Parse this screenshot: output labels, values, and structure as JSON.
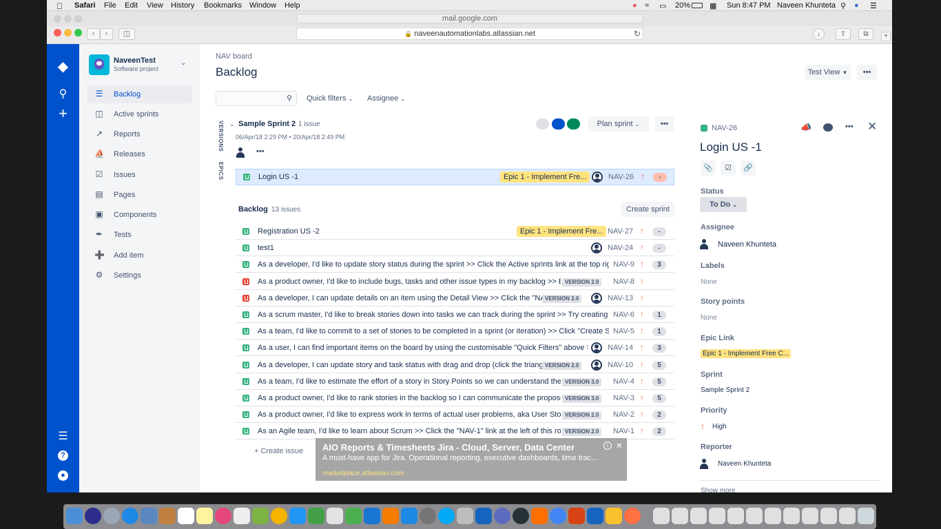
{
  "mac_menubar": {
    "apple": "",
    "items": [
      "Safari",
      "File",
      "Edit",
      "View",
      "History",
      "Bookmarks",
      "Window",
      "Help"
    ],
    "battery": "20%",
    "clock": "Sun 8:47 PM",
    "user": "Naveen Khunteta"
  },
  "browser": {
    "background_url": "mail.google.com",
    "url": "naveenautomationlabs.atlassian.net"
  },
  "project": {
    "name": "NaveenTest",
    "type": "Software project"
  },
  "sidebar": {
    "items": [
      {
        "label": "Backlog",
        "icon": "backlog-icon"
      },
      {
        "label": "Active sprints",
        "icon": "board-icon"
      },
      {
        "label": "Reports",
        "icon": "chart-icon"
      },
      {
        "label": "Releases",
        "icon": "ship-icon"
      },
      {
        "label": "Issues",
        "icon": "issues-icon"
      },
      {
        "label": "Pages",
        "icon": "page-icon"
      },
      {
        "label": "Components",
        "icon": "component-icon"
      },
      {
        "label": "Tests",
        "icon": "feather-icon"
      },
      {
        "label": "Add item",
        "icon": "add-item-icon"
      },
      {
        "label": "Settings",
        "icon": "gear-icon"
      }
    ]
  },
  "header": {
    "breadcrumb": "NAV board",
    "title": "Backlog",
    "view_button": "Test View",
    "more": "•••"
  },
  "filters": {
    "search_placeholder": "",
    "quick_filters": "Quick filters",
    "assignee": "Assignee"
  },
  "side_tabs": [
    "VERSIONS",
    "EPICS"
  ],
  "sprint": {
    "name": "Sample Sprint 2",
    "count": "1 issue",
    "dates": "06/Apr/18 2:29 PM • 20/Apr/18 2:49 PM",
    "plan_button": "Plan sprint",
    "colors": [
      "#dfe1e6",
      "#0052cc",
      "#00875a"
    ],
    "issue": {
      "title": "Login US -1",
      "epic": "Epic 1 - Implement Fre...",
      "key": "NAV-26",
      "points": "-"
    }
  },
  "backlog": {
    "title": "Backlog",
    "count": "13 issues",
    "create_sprint": "Create sprint",
    "create_issue": "+ Create issue",
    "rows": [
      {
        "type": "story",
        "title": "Registration US -2",
        "epic": "Epic 1 - Implement Fre...",
        "key": "NAV-27",
        "points": "-",
        "avatar": false,
        "version": ""
      },
      {
        "type": "story",
        "title": "test1",
        "epic": "",
        "key": "NAV-24",
        "points": "-",
        "avatar": true,
        "version": ""
      },
      {
        "type": "story",
        "title": "As a developer, I'd like to update story status during the sprint >> Click the Active sprints link at the top right",
        "epic": "",
        "key": "NAV-9",
        "points": "3",
        "avatar": false,
        "version": ""
      },
      {
        "type": "bug",
        "title": "As a product owner, I'd like to include bugs, tasks and other issue types in my backlog >> Bug",
        "epic": "",
        "key": "NAV-8",
        "points": "",
        "avatar": false,
        "version": "VERSION 2.0"
      },
      {
        "type": "bug",
        "title": "As a developer, I can update details on an item using the Detail View >> Click the \"NAV-",
        "epic": "",
        "key": "NAV-13",
        "points": "",
        "avatar": true,
        "version": "VERSION 2.0"
      },
      {
        "type": "story",
        "title": "As a scrum master, I'd like to break stories down into tasks we can track during the sprint >> Try creating a task",
        "epic": "",
        "key": "NAV-6",
        "points": "1",
        "avatar": false,
        "version": ""
      },
      {
        "type": "story",
        "title": "As a team, I'd like to commit to a set of stories to be completed in a sprint (or iteration) >> Click \"Create Sprint\"",
        "epic": "",
        "key": "NAV-5",
        "points": "1",
        "avatar": false,
        "version": ""
      },
      {
        "type": "story",
        "title": "As a user, I can find important items on the board by using the customisable \"Quick Filters\" above >> Try",
        "epic": "",
        "key": "NAV-14",
        "points": "3",
        "avatar": true,
        "version": ""
      },
      {
        "type": "story",
        "title": "As a developer, I can update story and task status with drag and drop (click the triangle",
        "epic": "",
        "key": "NAV-10",
        "points": "5",
        "avatar": true,
        "version": "VERSION 2.0"
      },
      {
        "type": "story",
        "title": "As a team, I'd like to estimate the effort of a story in Story Points so we can understand the work",
        "epic": "",
        "key": "NAV-4",
        "points": "5",
        "avatar": false,
        "version": "VERSION 3.0"
      },
      {
        "type": "story",
        "title": "As a product owner, I'd like to rank stories in the backlog so I can communicate the proposed",
        "epic": "",
        "key": "NAV-3",
        "points": "5",
        "avatar": false,
        "version": "VERSION 3.0"
      },
      {
        "type": "story",
        "title": "As a product owner, I'd like to express work in terms of actual user problems, aka User Stories",
        "epic": "",
        "key": "NAV-2",
        "points": "2",
        "avatar": false,
        "version": "VERSION 2.0"
      },
      {
        "type": "story",
        "title": "As an Agile team, I'd like to learn about Scrum >> Click the \"NAV-1\" link at the left of this row to",
        "epic": "",
        "key": "NAV-1",
        "points": "2",
        "avatar": false,
        "version": "VERSION 2.0"
      }
    ]
  },
  "detail": {
    "key": "NAV-26",
    "title": "Login US -1",
    "status_label": "Status",
    "status": "To Do",
    "assignee_label": "Assignee",
    "assignee": "Naveen Khunteta",
    "labels_label": "Labels",
    "labels": "None",
    "story_points_label": "Story points",
    "story_points": "None",
    "epic_label": "Epic Link",
    "epic": "Epic 1 - Implement Free C...",
    "sprint_label": "Sprint",
    "sprint": "Sample Sprint 2",
    "priority_label": "Priority",
    "priority": "High",
    "reporter_label": "Reporter",
    "reporter": "Naveen Khunteta",
    "show_more": "Show more"
  },
  "ad": {
    "title": "AIO Reports & Timesheets Jira - Cloud, Server, Data Center",
    "body": "A must-have app for Jira. Operational reporting, executive dashboards, time trac...",
    "link": "marketplace.atlassian.com"
  },
  "colors": {
    "primary": "#0052cc",
    "story": "#36b37e",
    "bug": "#e5493a",
    "epic": "#ffe380",
    "priority": "#ff7452"
  }
}
